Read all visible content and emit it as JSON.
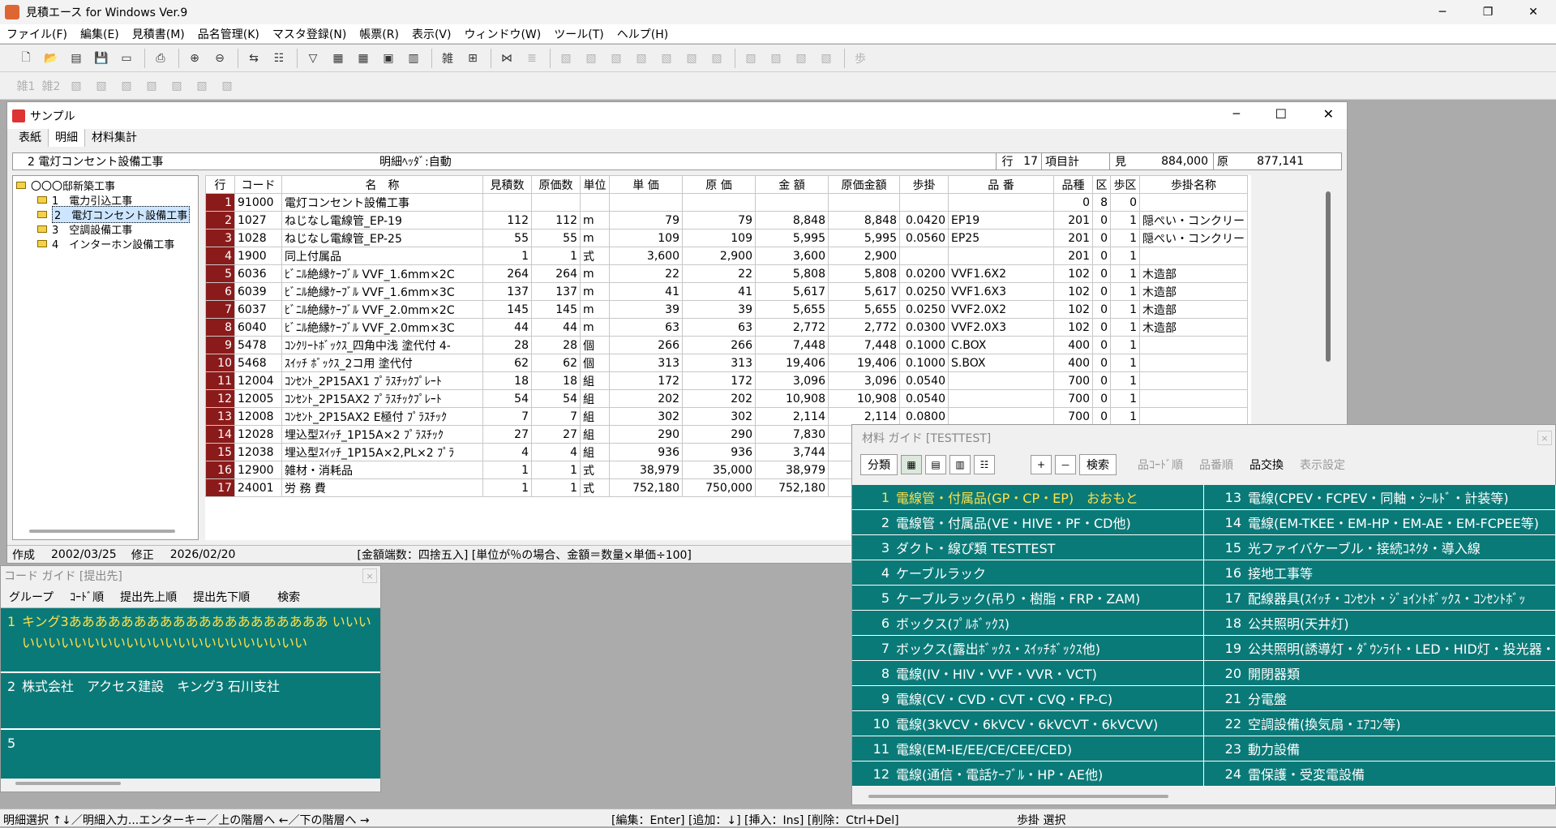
{
  "app": {
    "title": "見積エース for Windows Ver.9"
  },
  "menu": [
    "ファイル(F)",
    "編集(E)",
    "見積書(M)",
    "品名管理(K)",
    "マスタ登録(N)",
    "帳票(R)",
    "表示(V)",
    "ウィンドウ(W)",
    "ツール(T)",
    "ヘルプ(H)"
  ],
  "toolbar2": [
    "雑1",
    "雑2"
  ],
  "child": {
    "title": "サンプル",
    "tabs": [
      "表紙",
      "明細",
      "材料集計"
    ],
    "header": {
      "section": "2  電灯コンセント設備工事",
      "detail_header": "明細ﾍｯﾀﾞ:自動",
      "row_label": "行",
      "row_value": "17",
      "item_total": "項目計",
      "mi_label": "見",
      "mi_value": "884,000",
      "gen_label": "原",
      "gen_value": "877,141"
    },
    "tree": [
      "〇〇〇邸新築工事",
      "1　電力引込工事",
      "2　電灯コンセント設備工事",
      "3　空調設備工事",
      "4　インターホン設備工事"
    ],
    "columns": [
      "行",
      "コード",
      "名　称",
      "見積数",
      "原価数",
      "単位",
      "単 価",
      "原 価",
      "金 額",
      "原価金額",
      "歩掛",
      "品 番",
      "品種",
      "区",
      "歩区",
      "歩掛名称"
    ],
    "rows": [
      [
        "1",
        "91000",
        "電灯コンセント設備工事",
        "",
        "",
        "",
        "",
        "",
        "",
        "",
        "",
        "",
        "0",
        "8",
        "0",
        ""
      ],
      [
        "2",
        "1027",
        "ねじなし電線管_EP-19",
        "112",
        "112",
        "m",
        "79",
        "79",
        "8,848",
        "8,848",
        "0.0420",
        "EP19",
        "201",
        "0",
        "1",
        "隠ぺい・コンクリー"
      ],
      [
        "3",
        "1028",
        "ねじなし電線管_EP-25",
        "55",
        "55",
        "m",
        "109",
        "109",
        "5,995",
        "5,995",
        "0.0560",
        "EP25",
        "201",
        "0",
        "1",
        "隠ぺい・コンクリー"
      ],
      [
        "4",
        "1900",
        "同上付属品",
        "1",
        "1",
        "式",
        "3,600",
        "2,900",
        "3,600",
        "2,900",
        "",
        "",
        "201",
        "0",
        "1",
        ""
      ],
      [
        "5",
        "6036",
        "ﾋﾞﾆﾙ絶縁ｹｰﾌﾞﾙ VVF_1.6mm×2C",
        "264",
        "264",
        "m",
        "22",
        "22",
        "5,808",
        "5,808",
        "0.0200",
        "VVF1.6X2",
        "102",
        "0",
        "1",
        "木造部"
      ],
      [
        "6",
        "6039",
        "ﾋﾞﾆﾙ絶縁ｹｰﾌﾞﾙ VVF_1.6mm×3C",
        "137",
        "137",
        "m",
        "41",
        "41",
        "5,617",
        "5,617",
        "0.0250",
        "VVF1.6X3",
        "102",
        "0",
        "1",
        "木造部"
      ],
      [
        "7",
        "6037",
        "ﾋﾞﾆﾙ絶縁ｹｰﾌﾞﾙ VVF_2.0mm×2C",
        "145",
        "145",
        "m",
        "39",
        "39",
        "5,655",
        "5,655",
        "0.0250",
        "VVF2.0X2",
        "102",
        "0",
        "1",
        "木造部"
      ],
      [
        "8",
        "6040",
        "ﾋﾞﾆﾙ絶縁ｹｰﾌﾞﾙ VVF_2.0mm×3C",
        "44",
        "44",
        "m",
        "63",
        "63",
        "2,772",
        "2,772",
        "0.0300",
        "VVF2.0X3",
        "102",
        "0",
        "1",
        "木造部"
      ],
      [
        "9",
        "5478",
        "ｺﾝｸﾘｰﾄﾎﾞｯｸｽ_四角中浅 塗代付 4-",
        "28",
        "28",
        "個",
        "266",
        "266",
        "7,448",
        "7,448",
        "0.1000",
        "C.BOX",
        "400",
        "0",
        "1",
        ""
      ],
      [
        "10",
        "5468",
        "ｽｲｯﾁ ﾎﾞｯｸｽ_2コ用 塗代付",
        "62",
        "62",
        "個",
        "313",
        "313",
        "19,406",
        "19,406",
        "0.1000",
        "S.BOX",
        "400",
        "0",
        "1",
        ""
      ],
      [
        "11",
        "12004",
        "ｺﾝｾﾝﾄ_2P15AX1 ﾌﾟﾗｽﾁｯｸﾌﾟﾚｰﾄ",
        "18",
        "18",
        "組",
        "172",
        "172",
        "3,096",
        "3,096",
        "0.0540",
        "",
        "700",
        "0",
        "1",
        ""
      ],
      [
        "12",
        "12005",
        "ｺﾝｾﾝﾄ_2P15AX2 ﾌﾟﾗｽﾁｯｸﾌﾟﾚｰﾄ",
        "54",
        "54",
        "組",
        "202",
        "202",
        "10,908",
        "10,908",
        "0.0540",
        "",
        "700",
        "0",
        "1",
        ""
      ],
      [
        "13",
        "12008",
        "ｺﾝｾﾝﾄ_2P15AX2 E極付 ﾌﾟﾗｽﾁｯｸ",
        "7",
        "7",
        "組",
        "302",
        "302",
        "2,114",
        "2,114",
        "0.0800",
        "",
        "700",
        "0",
        "1",
        ""
      ],
      [
        "14",
        "12028",
        "埋込型ｽｲｯﾁ_1P15A×2 ﾌﾟﾗｽﾁｯｸ",
        "27",
        "27",
        "組",
        "290",
        "290",
        "7,830",
        "",
        "",
        "",
        "",
        "",
        "",
        ""
      ],
      [
        "15",
        "12038",
        "埋込型ｽｲｯﾁ_1P15A×2,PL×2 ﾌﾟﾗ",
        "4",
        "4",
        "組",
        "936",
        "936",
        "3,744",
        "",
        "",
        "",
        "",
        "",
        "",
        ""
      ],
      [
        "16",
        "12900",
        "雑材・消耗品",
        "1",
        "1",
        "式",
        "38,979",
        "35,000",
        "38,979",
        "",
        "",
        "",
        "",
        "",
        "",
        ""
      ],
      [
        "17",
        "24001",
        "労 務 費",
        "1",
        "1",
        "式",
        "752,180",
        "750,000",
        "752,180",
        "",
        "",
        "",
        "",
        "",
        "",
        ""
      ]
    ],
    "status": {
      "created_label": "作成",
      "created": "2002/03/25",
      "modified_label": "修正",
      "modified": "2026/02/20",
      "rounding": "[金額端数：四捨五入] [単位が％の場合、金額＝数量×単価÷100]"
    }
  },
  "code_guide": {
    "title": "コード ガイド [提出先]",
    "tabs": [
      "グループ",
      "ｺｰﾄﾞ順",
      "提出先上順",
      "提出先下順",
      "検索"
    ],
    "items": [
      {
        "num": "1",
        "text": "キング3ああああああああああああああああああああ いいいいいいいいいいいいいいいいいいいいいいいいい"
      },
      {
        "num": "2",
        "text": "株式会社　アクセス建設　キング3 石川支社"
      },
      {
        "num": "5",
        "text": ""
      }
    ],
    "close": "×"
  },
  "material_guide": {
    "title": "材料 ガイド [TESTTEST]",
    "close": "×",
    "buttons": {
      "bunrui": "分類",
      "plus": "+",
      "minus": "－",
      "search": "検索",
      "code_order": "品ｺｰﾄﾞ順",
      "part_order": "品番順",
      "exchange": "品交換",
      "display": "表示設定"
    },
    "left": [
      {
        "num": "1",
        "text": "電線管・付属品(GP・CP・EP)　おおもと"
      },
      {
        "num": "2",
        "text": "電線管・付属品(VE・HIVE・PF・CD他)"
      },
      {
        "num": "3",
        "text": "ダクト・線ぴ類 TESTTEST"
      },
      {
        "num": "4",
        "text": "ケーブルラック"
      },
      {
        "num": "5",
        "text": "ケーブルラック(吊り・樹脂・FRP・ZAM)"
      },
      {
        "num": "6",
        "text": "ボックス(ﾌﾟﾙﾎﾞｯｸｽ)"
      },
      {
        "num": "7",
        "text": "ボックス(露出ﾎﾞｯｸｽ・ｽｲｯﾁﾎﾞｯｸｽ他)"
      },
      {
        "num": "8",
        "text": "電線(IV・HIV・VVF・VVR・VCT)"
      },
      {
        "num": "9",
        "text": "電線(CV・CVD・CVT・CVQ・FP-C)"
      },
      {
        "num": "10",
        "text": "電線(3kVCV・6kVCV・6kVCVT・6kVCVV)"
      },
      {
        "num": "11",
        "text": "電線(EM-IE/EE/CE/CEE/CED)"
      },
      {
        "num": "12",
        "text": "電線(通信・電話ｹｰﾌﾞﾙ・HP・AE他)"
      }
    ],
    "right": [
      {
        "num": "13",
        "text": "電線(CPEV・FCPEV・同軸・ｼｰﾙﾄﾞ・計装等)"
      },
      {
        "num": "14",
        "text": "電線(EM-TKEE・EM-HP・EM-AE・EM-FCPEE等)"
      },
      {
        "num": "15",
        "text": "光ファイバケーブル・接続ｺﾈｸﾀ・導入線"
      },
      {
        "num": "16",
        "text": "接地工事等"
      },
      {
        "num": "17",
        "text": "配線器具(ｽｲｯﾁ・ｺﾝｾﾝﾄ・ｼﾞｮｲﾝﾄﾎﾞｯｸｽ・ｺﾝｾﾝﾄﾎﾞｯ"
      },
      {
        "num": "18",
        "text": "公共照明(天井灯)"
      },
      {
        "num": "19",
        "text": "公共照明(誘導灯・ﾀﾞｳﾝﾗｲﾄ・LED・HID灯・投光器・"
      },
      {
        "num": "20",
        "text": "開閉器類"
      },
      {
        "num": "21",
        "text": "分電盤"
      },
      {
        "num": "22",
        "text": "空調設備(換気扇・ｴｱｺﾝ等)"
      },
      {
        "num": "23",
        "text": "動力設備"
      },
      {
        "num": "24",
        "text": "雷保護・受変電設備"
      }
    ]
  },
  "bottom_status": {
    "left": "明細選択 ↑↓／明細入力...エンターキー／上の階層へ ←／下の階層へ →",
    "mid": "[編集：Enter] [追加：↓] [挿入：Ins] [削除：Ctrl+Del]",
    "right": "歩掛 選択"
  },
  "colors": {
    "teal": "#0a7a78",
    "row_number": "#8b1b1b",
    "highlight": "#ffe04a"
  }
}
